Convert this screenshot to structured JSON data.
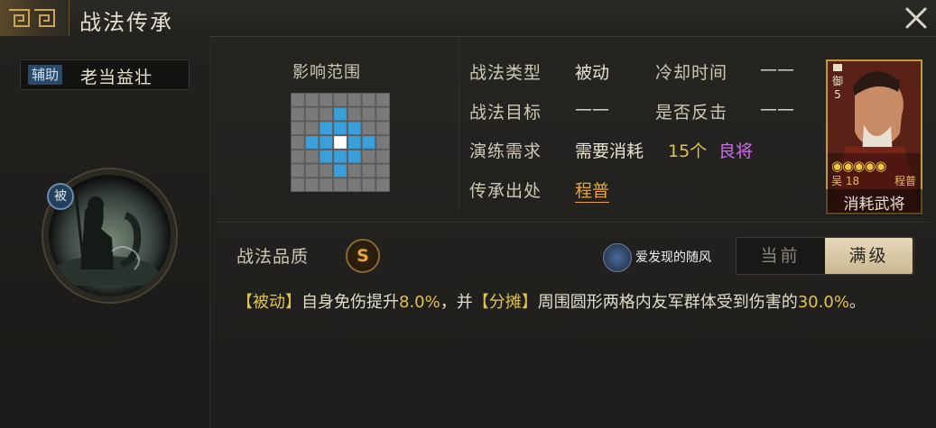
{
  "window": {
    "title": "战法传承",
    "close_icon": "close-icon"
  },
  "skill": {
    "tag": "辅助",
    "name": "老当益壮",
    "passive_marker": "被"
  },
  "range": {
    "label": "影响范围",
    "colors": {
      "empty": "#7a7a7a",
      "affected": "#3aa0dc",
      "center": "#ffffff"
    }
  },
  "info": {
    "type_label": "战法类型",
    "type_value": "被动",
    "cooldown_label": "冷却时间",
    "cooldown_value": "——",
    "target_label": "战法目标",
    "target_value": "——",
    "counter_label": "是否反击",
    "counter_value": "——",
    "requirement_label": "演练需求",
    "requirement_prefix": "需要消耗",
    "requirement_count": "15个",
    "requirement_item": "良将",
    "source_label": "传承出处",
    "source_value": "程普"
  },
  "general_card": {
    "tier": "御",
    "tier_num": "5",
    "stars": "◉◉◉◉◉",
    "faction": "吴",
    "cost": "18",
    "name": "程普",
    "caption": "消耗武将"
  },
  "quality": {
    "label": "战法品质",
    "grade": "S"
  },
  "watermark": {
    "text": "爱发现的随风"
  },
  "level_toggle": {
    "current": "当前",
    "max": "满级",
    "selected": "满级"
  },
  "description": {
    "kw1": "【被动】",
    "t1": "自身免伤提升",
    "n1": "8.0%",
    "t2": "，并",
    "kw2": "【分摊】",
    "t3": "周围圆形两格内友军群体受到伤害的",
    "n2": "30.0%",
    "t4": "。"
  }
}
